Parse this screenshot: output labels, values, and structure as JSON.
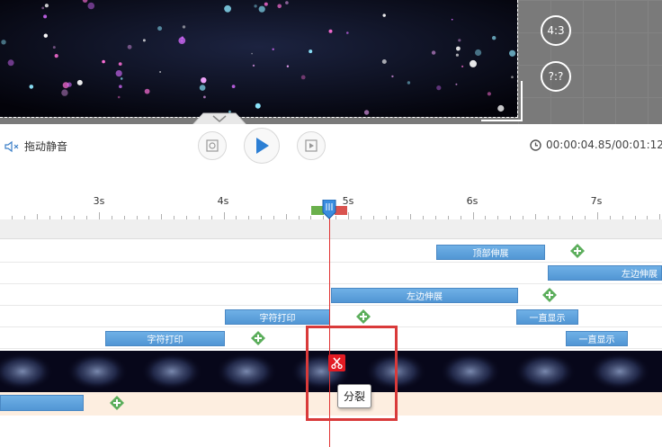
{
  "preview": {
    "ratio_buttons": [
      "4:3",
      "?:?"
    ]
  },
  "controls": {
    "mute_label": "拖动静音",
    "time_display": "00:00:04.85/00:01:12"
  },
  "ruler": {
    "labels": [
      "3s",
      "4s",
      "5s",
      "6s",
      "7s"
    ]
  },
  "tracks": [
    {
      "clips": [
        {
          "label": "顶部伸展"
        }
      ]
    },
    {
      "clips": [
        {
          "label": "左边伸展"
        }
      ]
    },
    {
      "clips": [
        {
          "label": "左边伸展"
        }
      ]
    },
    {
      "clips": [
        {
          "label": "字符打印"
        },
        {
          "label": "一直显示"
        }
      ]
    },
    {
      "clips": [
        {
          "label": "字符打印"
        },
        {
          "label": "一直显示"
        }
      ]
    }
  ],
  "tooltip": {
    "split_label": "分裂"
  },
  "colors": {
    "clip_blue": "#5a9fdb",
    "add_green": "#5cae5c",
    "playhead_red": "#e03030",
    "highlight_red": "#d93a3a",
    "audio_track": "#fdeee0"
  }
}
